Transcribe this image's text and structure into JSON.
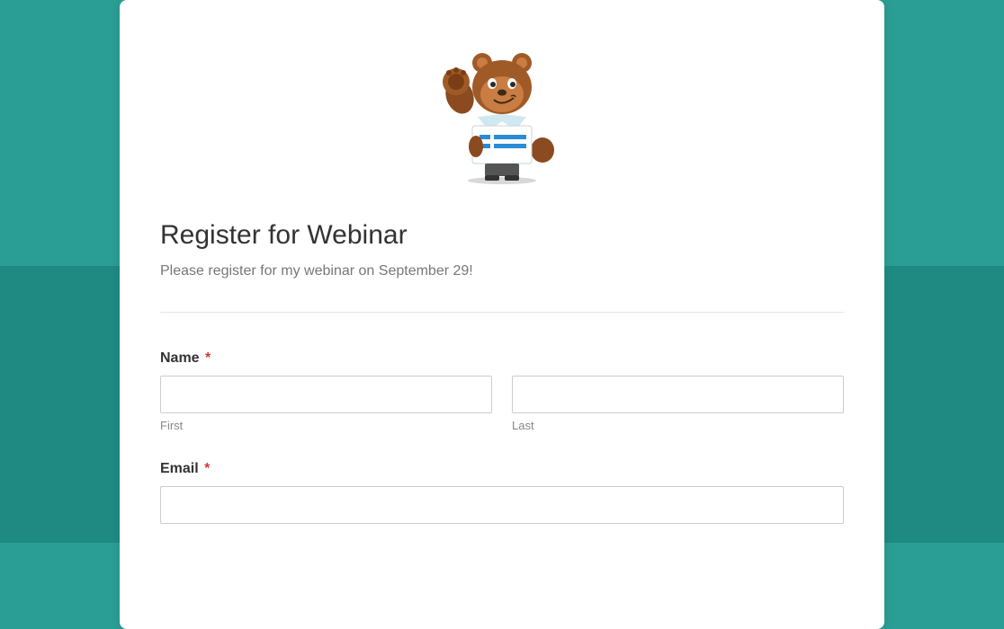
{
  "form": {
    "title": "Register for Webinar",
    "description": "Please register for my webinar on September 29!",
    "fields": {
      "name": {
        "label": "Name",
        "required_marker": "*",
        "first_sublabel": "First",
        "last_sublabel": "Last",
        "first_value": "",
        "last_value": ""
      },
      "email": {
        "label": "Email",
        "required_marker": "*",
        "value": ""
      }
    }
  },
  "mascot": {
    "name": "bear-mascot"
  },
  "colors": {
    "bg_top": "#2a9d94",
    "bg_bottom": "#1e8a82",
    "card": "#ffffff",
    "required": "#d63638"
  }
}
